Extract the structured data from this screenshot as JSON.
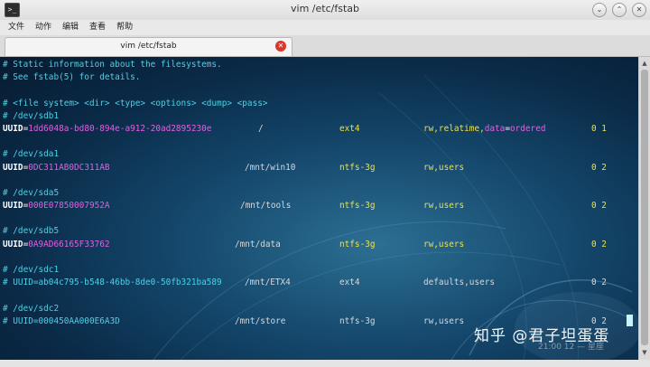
{
  "window": {
    "title": "vim /etc/fstab",
    "icon": "terminal-icon",
    "icon_glyph": ">_"
  },
  "window_buttons": [
    {
      "name": "minimize-button",
      "glyph": "⌄"
    },
    {
      "name": "maximize-button",
      "glyph": "⌃"
    },
    {
      "name": "close-button",
      "glyph": "✕"
    }
  ],
  "menu": [
    "文件",
    "动作",
    "编辑",
    "查看",
    "帮助"
  ],
  "tab": {
    "label": "vim /etc/fstab",
    "close_glyph": "✕"
  },
  "editor": {
    "comments": [
      "# Static information about the filesystems.",
      "# See fstab(5) for details.",
      "# <file system> <dir> <type> <options> <dump> <pass>"
    ],
    "entries": [
      {
        "device": "# /dev/sdb1",
        "commented": false,
        "key": "UUID",
        "value": "1dd6048a-bd80-894e-a912-20ad2895230e",
        "dir": "/",
        "type": "ext4",
        "options_parts": [
          "rw,relatime,",
          "data",
          "=",
          "ordered"
        ],
        "options": "",
        "nums": "0 1"
      },
      {
        "device": "# /dev/sda1",
        "commented": false,
        "key": "UUID",
        "value": "0DC311AB0DC311AB",
        "dir": "/mnt/win10",
        "type": "ntfs-3g",
        "options": "rw,users",
        "nums": "0 2"
      },
      {
        "device": "# /dev/sda5",
        "commented": false,
        "key": "UUID",
        "value": "000E07850007952A",
        "dir": "/mnt/tools",
        "type": "ntfs-3g",
        "options": "rw,users",
        "nums": "0 2"
      },
      {
        "device": "# /dev/sdb5",
        "commented": false,
        "key": "UUID",
        "value": "0A9AD66165F33762",
        "dir": "/mnt/data",
        "type": "ntfs-3g",
        "options": "rw,users",
        "nums": "0 2"
      },
      {
        "device": "# /dev/sdc1",
        "commented": true,
        "line": "# UUID=ab04c795-b548-46bb-8de0-50fb321ba589",
        "dir": "/mnt/ETX4",
        "type": "ext4",
        "options": "defaults,users",
        "nums": "0 2"
      },
      {
        "device": "# /dev/sdc2",
        "commented": true,
        "line": "# UUID=000450AA000E6A3D",
        "dir": "/mnt/store",
        "type": "ntfs-3g",
        "options": "rw,users",
        "nums": "0 2"
      }
    ]
  },
  "watermark": "知乎 @君子坦蛋蛋",
  "clock": "21:00 12 — 星座",
  "colors": {
    "comment": "#4fd0e6",
    "value": "#e060e0",
    "field": "#e8e055",
    "close": "#d9372a"
  }
}
